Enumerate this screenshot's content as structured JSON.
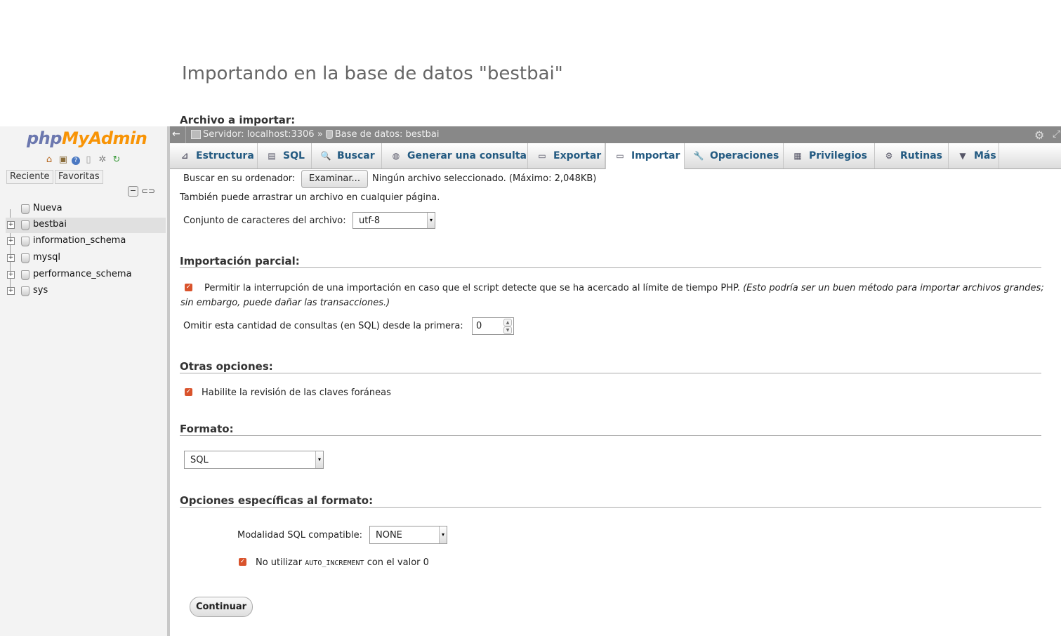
{
  "page": {
    "heading": "Importando en la base de datos \"bestbai\"",
    "file_section_title": "Archivo a importar:"
  },
  "sidebar": {
    "logo": {
      "php": "php",
      "my": "My",
      "admin": "Admin"
    },
    "icons": [
      "home-icon",
      "exit-icon",
      "help-icon",
      "docs-icon",
      "settings-icon",
      "reload-icon"
    ],
    "tabs": {
      "recent": "Reciente",
      "favorites": "Favoritas"
    },
    "tree": [
      {
        "label": "Nueva",
        "selected": false,
        "expandable": false
      },
      {
        "label": "bestbai",
        "selected": true,
        "expandable": true
      },
      {
        "label": "information_schema",
        "selected": false,
        "expandable": true
      },
      {
        "label": "mysql",
        "selected": false,
        "expandable": true
      },
      {
        "label": "performance_schema",
        "selected": false,
        "expandable": true
      },
      {
        "label": "sys",
        "selected": false,
        "expandable": true
      }
    ]
  },
  "topbar": {
    "back": "←",
    "server": "Servidor: localhost:3306",
    "separator": "»",
    "database": "Base de datos: bestbai"
  },
  "tabs": [
    {
      "label": "Estructura",
      "icon": "structure-icon",
      "active": false
    },
    {
      "label": "SQL",
      "icon": "sql-icon",
      "active": false
    },
    {
      "label": "Buscar",
      "icon": "search-icon",
      "active": false
    },
    {
      "label": "Generar una consulta",
      "icon": "query-icon",
      "active": false
    },
    {
      "label": "Exportar",
      "icon": "export-icon",
      "active": false
    },
    {
      "label": "Importar",
      "icon": "import-icon",
      "active": true
    },
    {
      "label": "Operaciones",
      "icon": "wrench-icon",
      "active": false
    },
    {
      "label": "Privilegios",
      "icon": "privileges-icon",
      "active": false
    },
    {
      "label": "Rutinas",
      "icon": "routines-icon",
      "active": false
    },
    {
      "label": "Más",
      "icon": "chevron-down-icon",
      "active": false
    }
  ],
  "file": {
    "browse_label": "Buscar en su ordenador:",
    "browse_button": "Examinar...",
    "no_file": "Ningún archivo seleccionado. (Máximo: 2,048KB)",
    "drag_hint": "También puede arrastrar un archivo en cualquier página.",
    "charset_label": "Conjunto de caracteres del archivo:",
    "charset_value": "utf-8"
  },
  "partial": {
    "title": "Importación parcial:",
    "allow_interrupt_label": "Permitir la interrupción de una importación en caso que el script detecte que se ha acercado al límite de tiempo PHP.",
    "allow_interrupt_note_1": "(Esto podría ser un buen método para importar archivos grandes;",
    "allow_interrupt_note_2": "sin embargo, puede dañar las transacciones.)",
    "allow_interrupt_checked": true,
    "skip_label": "Omitir esta cantidad de consultas (en SQL) desde la primera:",
    "skip_value": "0"
  },
  "other": {
    "title": "Otras opciones:",
    "fk_label": "Habilite la revisión de las claves foráneas",
    "fk_checked": true
  },
  "format": {
    "title": "Formato:",
    "value": "SQL"
  },
  "format_options": {
    "title": "Opciones específicas al formato:",
    "compat_label": "Modalidad SQL compatible:",
    "compat_value": "NONE",
    "no_auto_pre": "No utilizar",
    "no_auto_code": "AUTO_INCREMENT",
    "no_auto_post": "con el valor 0",
    "no_auto_checked": true
  },
  "continue_button": "Continuar",
  "colors": {
    "accent_link": "#235a81",
    "checkbox": "#d9532c",
    "topbar": "#888888",
    "logo_php": "#6c78af",
    "logo_myadmin": "#f89406"
  }
}
